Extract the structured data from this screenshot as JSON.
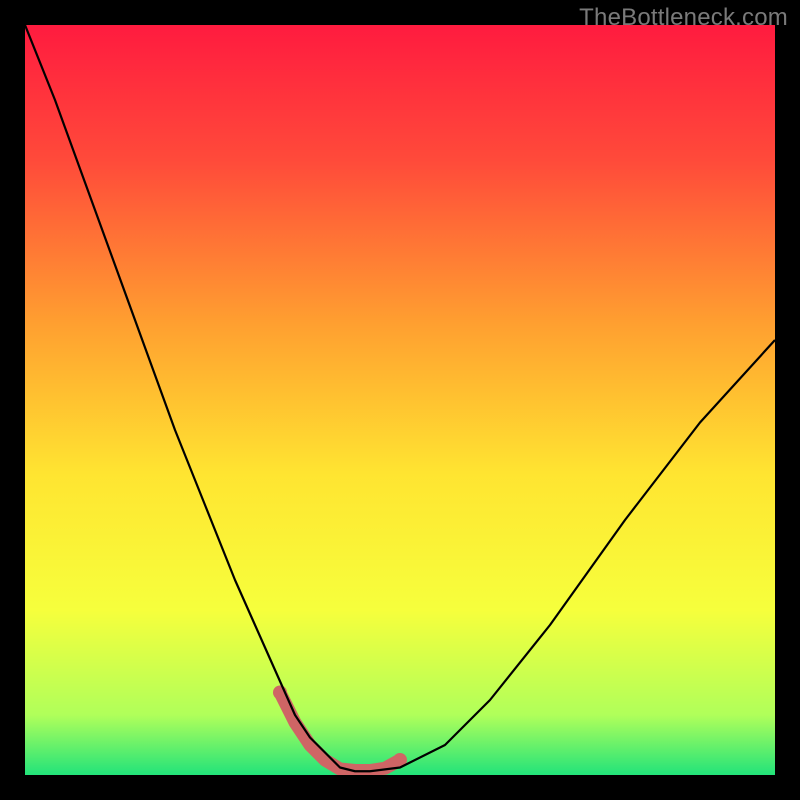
{
  "watermark": "TheBottleneck.com",
  "chart_data": {
    "type": "line",
    "title": "",
    "xlabel": "",
    "ylabel": "",
    "x_range": [
      0,
      100
    ],
    "y_range": [
      0,
      100
    ],
    "gradient_stops": [
      {
        "offset": 0,
        "color": "#ff1b3f"
      },
      {
        "offset": 0.18,
        "color": "#ff4a3a"
      },
      {
        "offset": 0.4,
        "color": "#ffa030"
      },
      {
        "offset": 0.6,
        "color": "#ffe531"
      },
      {
        "offset": 0.78,
        "color": "#f6ff3c"
      },
      {
        "offset": 0.92,
        "color": "#b0ff5a"
      },
      {
        "offset": 1.0,
        "color": "#22e37a"
      }
    ],
    "series": [
      {
        "name": "bottleneck-curve",
        "x": [
          0,
          4,
          8,
          12,
          16,
          20,
          24,
          28,
          32,
          36,
          38,
          40,
          42,
          44,
          46,
          50,
          56,
          62,
          70,
          80,
          90,
          100
        ],
        "y": [
          100,
          90,
          79,
          68,
          57,
          46,
          36,
          26,
          17,
          8,
          5,
          3,
          1,
          0.5,
          0.5,
          1,
          4,
          10,
          20,
          34,
          47,
          58
        ],
        "color": "#000000",
        "width": 2.2
      }
    ],
    "highlight": {
      "name": "optimal-region",
      "color": "#cf6565",
      "width": 13,
      "linecap": "round",
      "x": [
        34,
        36,
        38,
        40,
        42,
        44,
        46,
        48,
        50
      ],
      "y": [
        11,
        7,
        4,
        2,
        0.8,
        0.6,
        0.6,
        0.9,
        2
      ]
    },
    "highlight_dots": {
      "color": "#cf6565",
      "radius": 7,
      "points": [
        {
          "x": 34,
          "y": 11
        },
        {
          "x": 50,
          "y": 2
        }
      ]
    }
  }
}
